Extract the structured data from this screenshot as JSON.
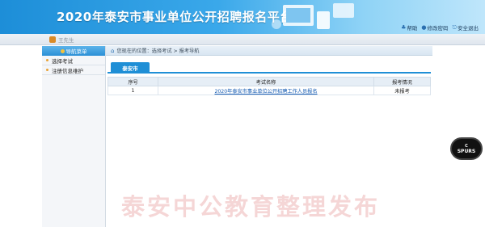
{
  "header": {
    "title": "2020年泰安市事业单位公开招聘报名平台",
    "links": [
      {
        "icon": "help-icon",
        "label": "帮助"
      },
      {
        "icon": "password-icon",
        "label": "修改密码"
      },
      {
        "icon": "logout-icon",
        "label": "安全退出"
      }
    ]
  },
  "user": {
    "name": "王先生"
  },
  "sidebar": {
    "title": "导航菜单",
    "items": [
      {
        "label": "选择考试"
      },
      {
        "label": "注册信息维护"
      }
    ]
  },
  "breadcrumb": {
    "text": "您现在的位置：选择考试 > 报考导航"
  },
  "tabs": [
    {
      "label": "泰安市"
    }
  ],
  "table": {
    "headers": [
      "序号",
      "考试名称",
      "报考情况"
    ],
    "rows": [
      {
        "index": "1",
        "name": "2020年泰安市事业单位公开招聘工作人员报名",
        "status": "未报考"
      }
    ]
  },
  "badge": {
    "text": "SPURS",
    "top": "C"
  },
  "watermark": "泰安中公教育整理发布",
  "colors": {
    "accent": "#1f8fd6",
    "banner_start": "#1d8ed8",
    "link": "#1a5fb4"
  }
}
